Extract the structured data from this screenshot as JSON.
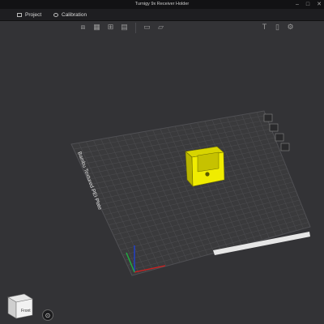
{
  "window": {
    "title": "Turnigy 9x Receiver Holder",
    "controls": [
      "–",
      "□",
      "✕"
    ]
  },
  "menu": {
    "tabs": [
      {
        "label": "Project",
        "icon": "project-icon"
      },
      {
        "label": "Calibration",
        "icon": "calibration-icon"
      }
    ]
  },
  "toolbar": {
    "left_icons": [
      "add-cube-icon",
      "arrange-icon",
      "split-icon",
      "layers-icon",
      "orient-icon",
      "cut-icon"
    ],
    "right_icons": [
      "text-icon",
      "measure-icon",
      "settings-icon"
    ]
  },
  "plate": {
    "label": "Bambu Textured PEI Plate",
    "side_icons": [
      "plate-settings-icon",
      "plate-lock-icon",
      "plate-arrange-icon",
      "plate-orient-icon"
    ]
  },
  "navigation_cube": {
    "face_label": "Front"
  },
  "colors": {
    "model": "#e8e400",
    "bed": "#3c3c3e",
    "grid": "#4a4a4c",
    "axis_x": "#d02020",
    "axis_y": "#20b040",
    "axis_z": "#2040d0"
  }
}
